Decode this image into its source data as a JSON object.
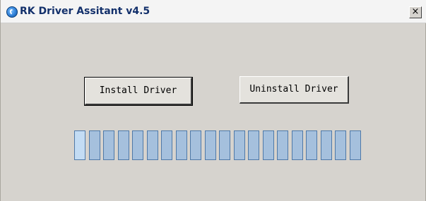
{
  "window": {
    "title": "RK Driver Assitant v4.5",
    "close_glyph": "×",
    "icon": "app-logo-icon",
    "background_color": "#d6d3ce"
  },
  "buttons": {
    "install_label": "Install Driver",
    "uninstall_label": "Uninstall Driver"
  },
  "progress": {
    "segment_count": 20,
    "active_segments": 1,
    "segment_color": "#a5c0dd",
    "active_segment_color": "#c3dcf4",
    "border_color": "#4f79a8"
  }
}
